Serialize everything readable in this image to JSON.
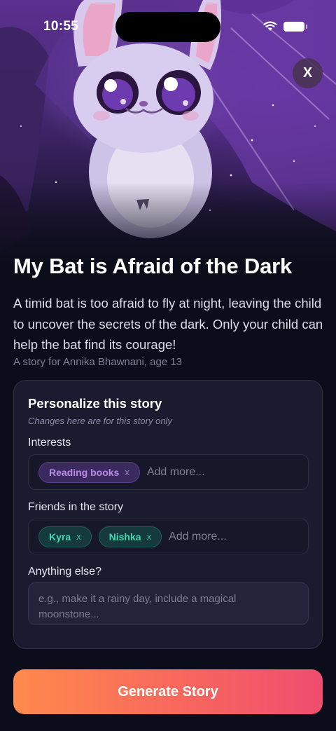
{
  "status_bar": {
    "time": "10:55"
  },
  "hero": {
    "image_description_icon": "bat-illustration-icon"
  },
  "close_button": {
    "label": "X"
  },
  "story": {
    "title": "My Bat is Afraid of the Dark",
    "description": "A timid bat is too afraid to fly at night, leaving the child to uncover the secrets of the dark. Only your child can help the bat find its courage!",
    "for_line": "A story for Annika Bhawnani, age 13"
  },
  "personalize": {
    "title": "Personalize this story",
    "subtitle": "Changes here are for this story only",
    "interests": {
      "label": "Interests",
      "chips": [
        "Reading books"
      ],
      "add_more": "Add more..."
    },
    "friends": {
      "label": "Friends in the story",
      "chips": [
        "Kyra",
        "Nishka"
      ],
      "add_more": "Add more..."
    },
    "anything_else": {
      "label": "Anything else?",
      "placeholder": "e.g., make it a rainy day, include a magical moonstone..."
    },
    "chip_remove": "x"
  },
  "generate_button": {
    "label": "Generate Story"
  },
  "colors": {
    "background": "#0c0d1a",
    "interest_chip": "#b98ae6",
    "friend_chip": "#3ddcb4",
    "button_start": "#ff8a4c",
    "button_end": "#ef4d6e"
  }
}
